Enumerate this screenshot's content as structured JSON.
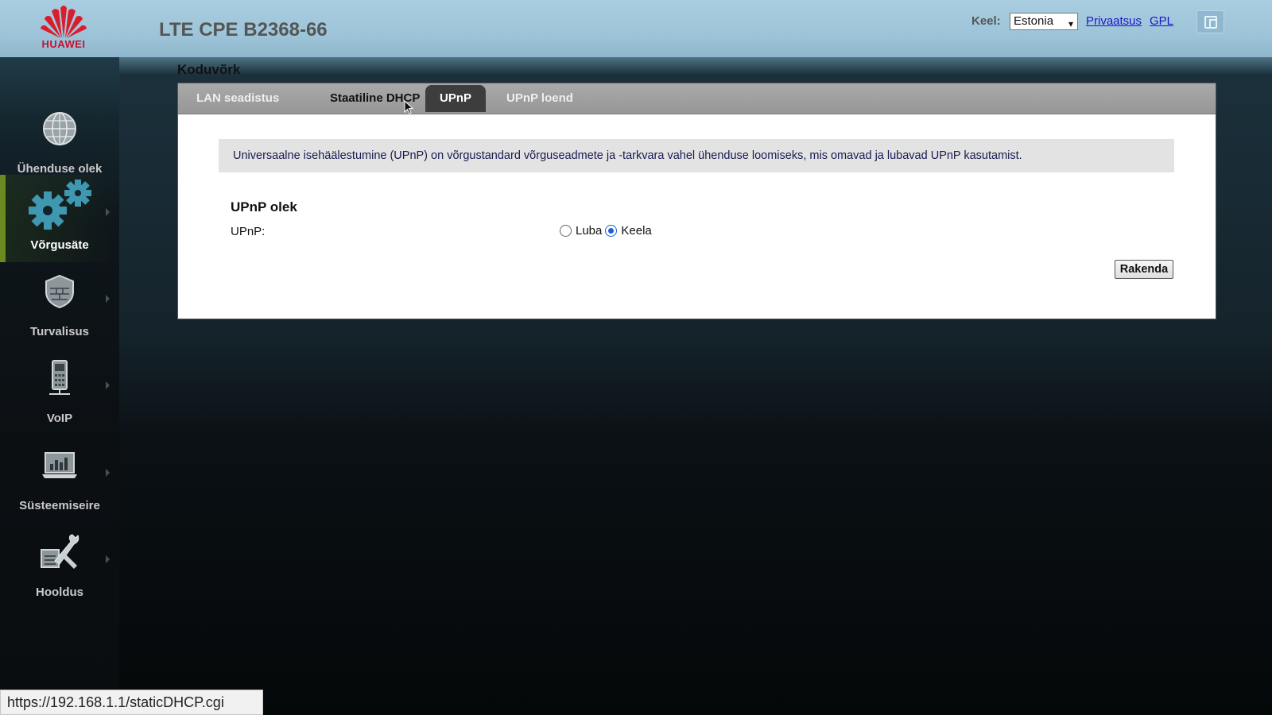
{
  "header": {
    "logo_text": "HUAWEI",
    "title": "LTE CPE B2368-66",
    "language_label": "Keel:",
    "language_selected": "Estonia",
    "privacy_link": "Privaatsus",
    "gpl_link": "GPL"
  },
  "sidebar": {
    "items": [
      {
        "label": "Ühenduse olek",
        "icon": "globe-icon"
      },
      {
        "label": "Võrgusäte",
        "icon": "gears-icon",
        "active": true
      },
      {
        "label": "Turvalisus",
        "icon": "shield-icon"
      },
      {
        "label": "VoIP",
        "icon": "phone-icon"
      },
      {
        "label": "Süsteemiseire",
        "icon": "monitor-icon"
      },
      {
        "label": "Hooldus",
        "icon": "wrench-icon"
      }
    ]
  },
  "main": {
    "section_title": "Koduvõrk",
    "tabs": [
      {
        "label": "LAN seadistus"
      },
      {
        "label": "Staatiline DHCP"
      },
      {
        "label": "UPnP",
        "active": true
      },
      {
        "label": "UPnP loend"
      }
    ],
    "info_text": "Universaalne isehäälestumine (UPnP) on võrgustandard võrguseadmete ja -tarkvara vahel ühenduse loomiseks, mis omavad ja lubavad UPnP kasutamist.",
    "subsection_title": "UPnP olek",
    "field_label": "UPnP:",
    "options": [
      {
        "label": "Luba",
        "checked": false
      },
      {
        "label": "Keela",
        "checked": true
      }
    ],
    "apply_label": "Rakenda"
  },
  "statusbar": {
    "url": "https://192.168.1.1/staticDHCP.cgi"
  },
  "colors": {
    "accent_active": "#6b8a1f",
    "link": "#1a16cc",
    "brand_red": "#c8102e"
  }
}
